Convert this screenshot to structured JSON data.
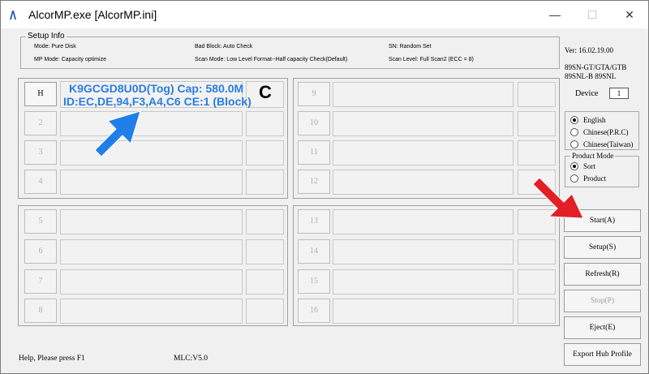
{
  "window": {
    "title": "AlcorMP.exe [AlcorMP.ini]",
    "min_glyph": "—",
    "max_glyph": "☐",
    "close_glyph": "✕"
  },
  "setup_info": {
    "title": "Setup Info",
    "mode": "Mode: Pure Disk",
    "mp_mode": "MP Mode: Capacity optimize",
    "bad_block": "Bad Block: Auto Check",
    "scan_mode": "Scan Mode: Low Level Format--Half capacity Check(Default)",
    "sn": "SN: Random Set",
    "scan_level": "Scan Level: Full Scan2 (ECC = 8)"
  },
  "ports": {
    "left_top": [
      "H",
      "2",
      "3",
      "4"
    ],
    "left_bottom": [
      "5",
      "6",
      "7",
      "8"
    ],
    "right_top": [
      "9",
      "10",
      "11",
      "12"
    ],
    "right_bottom": [
      "13",
      "14",
      "15",
      "16"
    ]
  },
  "device_info": {
    "line1": "K9GCGD8U0D(Tog) Cap: 580.0M",
    "line2": "ID:EC,DE,94,F3,A4,C6 CE:1 (Block)",
    "status_letter": "C"
  },
  "version": "Ver: 16.02.19.00",
  "models": [
    "89SN-GT/GTA/GTB",
    "89SNL-B 89SNL"
  ],
  "device": {
    "label": "Device",
    "value": "1"
  },
  "language": {
    "options": [
      "English",
      "Chinese(P.R.C)",
      "Chinese(Taiwan)"
    ],
    "selected": "English"
  },
  "product_mode": {
    "title": "Product Mode",
    "options": [
      "Sort",
      "Product"
    ],
    "selected": "Sort"
  },
  "actions": {
    "start": "Start(A)",
    "setup": "Setup(S)",
    "refresh": "Refresh(R)",
    "stop": "Stop(P)",
    "eject": "Eject(E)",
    "export": "Export Hub Profile"
  },
  "statusbar": {
    "help": "Help, Please press F1",
    "mlc": "MLC:V5.0"
  },
  "colors": {
    "annotation_blue": "#1e7fe8",
    "annotation_red": "#e21f26",
    "device_text": "#2a7de1"
  }
}
